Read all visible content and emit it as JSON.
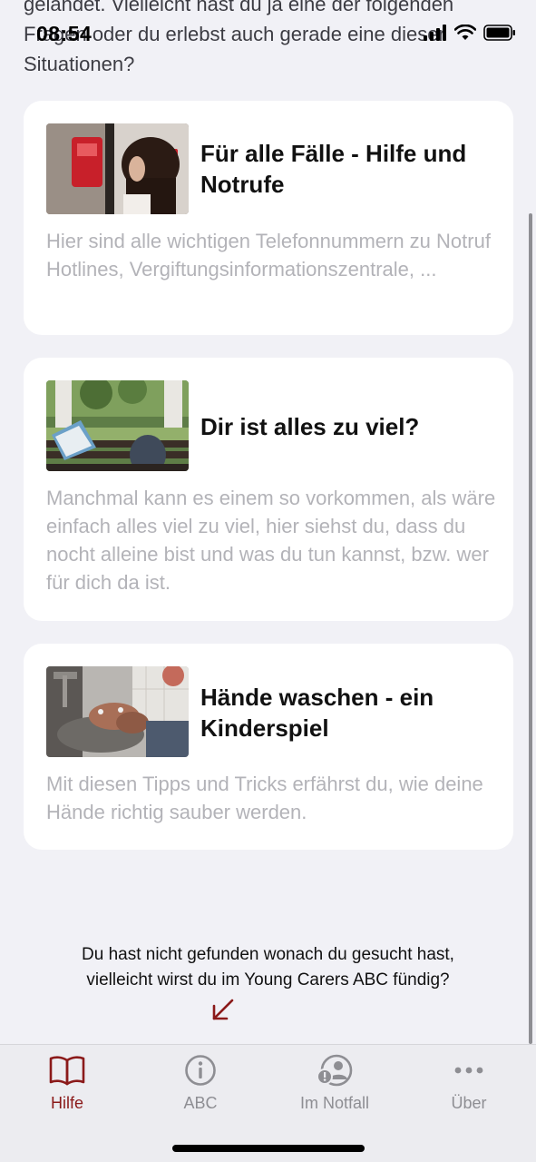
{
  "status": {
    "time": "08:54"
  },
  "intro": {
    "text": "gelandet. Vielleicht hast du ja eine der folgenden Fragen oder du erlebst auch gerade eine dieser Situationen?"
  },
  "cards": [
    {
      "title": "Für alle Fälle - Hilfe und Notrufe",
      "description": "Hier sind alle wichtigen Telefonnummern zu Notruf Hotlines, Vergiftungsinformationszentrale, ..."
    },
    {
      "title": "Dir ist alles zu viel?",
      "description": "Manchmal kann es einem so vorkommen, als wäre einfach alles viel zu viel, hier siehst du, dass du nocht alleine bist und was du tun kannst, bzw. wer für dich da ist."
    },
    {
      "title": "Hände waschen - ein Kinderspiel",
      "description": "Mit diesen Tipps und Tricks erfährst du, wie deine Hände richtig sauber werden."
    }
  ],
  "footer": {
    "line1": "Du hast nicht gefunden wonach du gesucht hast,",
    "line2": "vielleicht wirst du im Young Carers ABC fündig?"
  },
  "tabs": [
    {
      "label": "Hilfe",
      "icon": "book-icon",
      "active": true
    },
    {
      "label": "ABC",
      "icon": "info-icon",
      "active": false
    },
    {
      "label": "Im Notfall",
      "icon": "emergency-person-icon",
      "active": false
    },
    {
      "label": "Über",
      "icon": "more-icon",
      "active": false
    }
  ],
  "colors": {
    "accent": "#8b1a1a",
    "background": "#f1f1f6",
    "card": "#ffffff",
    "muted": "#b3b3b8"
  }
}
